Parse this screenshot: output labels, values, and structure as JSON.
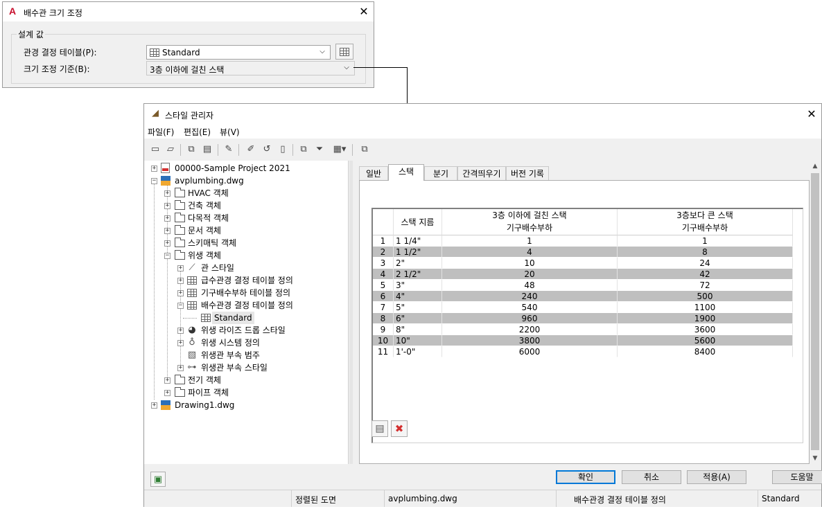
{
  "dialog1": {
    "title": "배수관 크기 조정",
    "group_label": "설계 값",
    "table_label": "관경 결정 테이블(P):",
    "table_value": "Standard",
    "basis_label": "크기 조정 기준(B):",
    "basis_value": "3층 이하에 걸친 스택"
  },
  "style_manager": {
    "title": "스타일 관리자",
    "menus": [
      "파일(F)",
      "편집(E)",
      "뷰(V)"
    ],
    "tree": {
      "project": "00000-Sample Project 2021",
      "file1": "avplumbing.dwg",
      "folders": [
        "HVAC 객체",
        "건축 객체",
        "다목적 객체",
        "문서 객체",
        "스키매틱 객체",
        "위생 객체"
      ],
      "plumbing_children": [
        "관 스타일",
        "급수관경 결정 테이블 정의",
        "기구배수부하 테이블 정의",
        "배수관경 결정 테이블 정의"
      ],
      "standard": "Standard",
      "plumbing_children2": [
        "위생 라이즈 드롭 스타일",
        "위생 시스템 정의",
        "위생관 부속 범주",
        "위생관 부속 스타일"
      ],
      "folders2": [
        "전기 객체",
        "파이프 객체"
      ],
      "file2": "Drawing1.dwg"
    },
    "tabs": [
      "일반",
      "스택",
      "분기",
      "간격띄우기",
      "버전 기록"
    ],
    "grid": {
      "headers": [
        "스택 지름",
        "3층 이하에 걸친 스택\n기구배수부하",
        "3층보다 큰 스택\n기구배수부하"
      ],
      "rows": [
        [
          "1",
          "1 1/4\"",
          "1",
          "1"
        ],
        [
          "2",
          "1 1/2\"",
          "4",
          "8"
        ],
        [
          "3",
          "2\"",
          "10",
          "24"
        ],
        [
          "4",
          "2 1/2\"",
          "20",
          "42"
        ],
        [
          "5",
          "3\"",
          "48",
          "72"
        ],
        [
          "6",
          "4\"",
          "240",
          "500"
        ],
        [
          "7",
          "5\"",
          "540",
          "1100"
        ],
        [
          "8",
          "6\"",
          "960",
          "1900"
        ],
        [
          "9",
          "8\"",
          "2200",
          "3600"
        ],
        [
          "10",
          "10\"",
          "3800",
          "5600"
        ],
        [
          "11",
          "1'-0\"",
          "6000",
          "8400"
        ]
      ]
    },
    "buttons": {
      "ok": "확인",
      "cancel": "취소",
      "apply": "적용(A)",
      "help": "도움말"
    },
    "status": {
      "sort": "정렬된 도면",
      "file": "avplumbing.dwg",
      "category": "배수관경 결정 테이블 정의",
      "style": "Standard"
    }
  },
  "colors": {
    "accent": "#0078d7",
    "autocad_red": "#c8102e",
    "stripe": "#bfbfbf"
  }
}
